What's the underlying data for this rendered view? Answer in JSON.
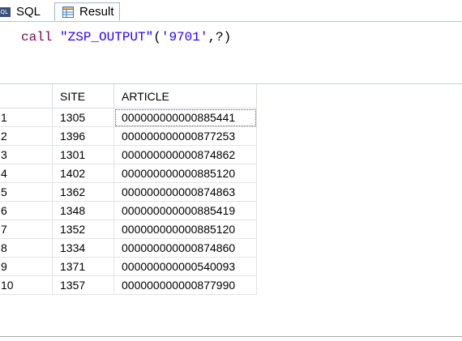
{
  "tabs": {
    "sql_icon_text": "SQL",
    "sql_label": "SQL",
    "result_label": "Result"
  },
  "editor": {
    "keyword": "call",
    "procedure": "\"ZSP_OUTPUT\"",
    "open_paren": "(",
    "arg1": "'9701'",
    "rest": ",?)"
  },
  "table": {
    "columns": [
      "",
      "SITE",
      "ARTICLE"
    ],
    "rows": [
      {
        "idx": "1",
        "site": "1305",
        "article": "000000000000885441"
      },
      {
        "idx": "2",
        "site": "1396",
        "article": "000000000000877253"
      },
      {
        "idx": "3",
        "site": "1301",
        "article": "000000000000874862"
      },
      {
        "idx": "4",
        "site": "1402",
        "article": "000000000000885120"
      },
      {
        "idx": "5",
        "site": "1362",
        "article": "000000000000874863"
      },
      {
        "idx": "6",
        "site": "1348",
        "article": "000000000000885419"
      },
      {
        "idx": "7",
        "site": "1352",
        "article": "000000000000885120"
      },
      {
        "idx": "8",
        "site": "1334",
        "article": "000000000000874860"
      },
      {
        "idx": "9",
        "site": "1371",
        "article": "000000000000540093"
      },
      {
        "idx": "10",
        "site": "1357",
        "article": "000000000000877990"
      }
    ]
  },
  "icons": {
    "sql_tab": "sql-icon",
    "result_tab": "table-grid-icon"
  },
  "colors": {
    "keyword": "#7f0055",
    "string": "#2a00ff"
  }
}
